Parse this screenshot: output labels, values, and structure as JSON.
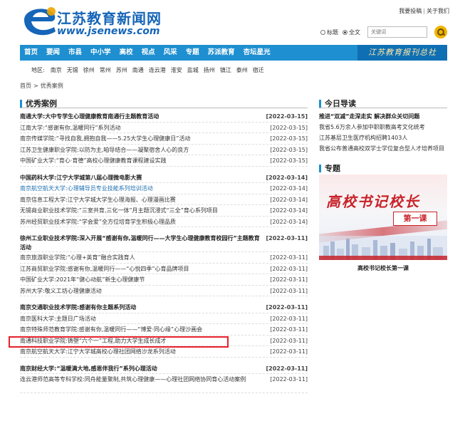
{
  "header": {
    "site_name": "江苏教育新闻网",
    "site_url": "www.jsenews.com",
    "top_links": [
      "我要投稿",
      "关于我们"
    ],
    "search": {
      "radio_title": "标题",
      "radio_full": "全文",
      "placeholder": "关键词"
    }
  },
  "nav": {
    "items": [
      "首页",
      "要闻",
      "市县",
      "中小学",
      "高校",
      "视点",
      "风采",
      "专题",
      "苏派教育",
      "杏坛星光"
    ],
    "banner": "江苏教育报刊总社"
  },
  "region": {
    "label": "地区:",
    "items": [
      "南京",
      "无锡",
      "徐州",
      "常州",
      "苏州",
      "南通",
      "连云港",
      "淮安",
      "盐城",
      "扬州",
      "镇江",
      "泰州",
      "宿迁"
    ]
  },
  "breadcrumb": [
    "首页",
    "优秀案例"
  ],
  "left": {
    "title": "优秀案例",
    "groups": [
      {
        "head": {
          "text": "南通大学:大中专学生心理健康教育南通行主题教育活动",
          "date": "[2022-03-15]"
        },
        "rows": [
          {
            "text": "江南大学:“感谢有你,温暖同行”系列活动",
            "date": "[2022-03-15]"
          },
          {
            "text": "南京传媒学院:“寻找自我,拥抱自我——5.25大学生心理健康日”活动",
            "date": "[2022-03-15]"
          },
          {
            "text": "江苏卫生健康职业学院:以防为主,咱导结合——凝聚宿舍人心的良方",
            "date": "[2022-03-15]"
          },
          {
            "text": "中国矿业大学:“育心·育德”高校心理健康教育课程建设实践",
            "date": "[2022-03-15]"
          }
        ]
      },
      {
        "head": {
          "text": "中国药科大学:江宁大学城第八届心理微电影大赛",
          "date": "[2022-03-14]"
        },
        "rows": [
          {
            "text": "南京航空航天大学:心理辅导员专业技能系列培训活动",
            "date": "[2022-03-14]",
            "link": true
          },
          {
            "text": "南京信息工程大学:江宁大学城大学生心理海报、心理漫画比赛",
            "date": "[2022-03-14]"
          },
          {
            "text": "无锡商业职业技术学院:“三室共育,三化一体”月主题沉浸式“三全”育心系列项目",
            "date": "[2022-03-14]"
          },
          {
            "text": "苏州经贸职业技术学院:“学会爱”全方位培育学生积极心理品质",
            "date": "[2022-03-14]"
          }
        ]
      },
      {
        "head": {
          "text": "徐州工业职业技术学院:深入开展“感谢有你,温暖同行——大学生心理健康教育校园行”主题教育活动",
          "date": "[2022-03-11]",
          "tall": true
        },
        "rows": [
          {
            "text": "南京旅游职业学院:“心理+英育”融合实践育人",
            "date": "[2022-03-11]"
          },
          {
            "text": "江苏商贸职业学院:感谢有你,温暖同行——“心悦四季”心育品牌项目",
            "date": "[2022-03-11]"
          },
          {
            "text": "中国矿业大学:2021年“健心动航”新生心理健康节",
            "date": "[2022-03-11]"
          },
          {
            "text": "苏州大学:敬义工坊心理健康活动",
            "date": "[2022-03-11]"
          }
        ]
      },
      {
        "head": {
          "text": "南京交通职业技术学院:感谢有你主题系列活动",
          "date": "[2022-03-11]"
        },
        "rows": [
          {
            "text": "南京医科大学:主题日广场活动",
            "date": "[2022-03-11]"
          },
          {
            "text": "南京特殊师范教育学院:感谢有你,温暖同行——“博爱·同心缘”心理沙画会",
            "date": "[2022-03-11]"
          },
          {
            "text": "南通科技职业学院:铸塑“六个一”工程,助力大学生成长成才",
            "date": "[2022-03-11]"
          },
          {
            "text": "南京航空航天大学:江宁大学城高校心理社团网络沙龙系列活动",
            "date": "[2022-03-11]"
          }
        ]
      },
      {
        "head": {
          "text": "南京财经大学:“温暖满大地,感恩伴我行”系列心理活动",
          "date": "[2022-03-11]"
        },
        "rows": [
          {
            "text": "连云港师范高等专科学校:同舟能量聚制,共筑心理健康——心理社团网络协同育心活动案例",
            "date": "[2022-03-11]",
            "tall": true
          }
        ]
      }
    ]
  },
  "right": {
    "today_title": "今日导读",
    "today_items": [
      {
        "text": "推进“双减”走深走实 解决群众关切问题",
        "bold": true
      },
      {
        "text": "我省5.6万余人参加中职职教高考文化统考",
        "bold": false
      },
      {
        "text": "江苏基层卫生医疗机构招聘1403人",
        "bold": false
      },
      {
        "text": "我省公布普通高校双学士学位复合型人才培养项目",
        "bold": false
      }
    ],
    "special_title": "专题",
    "special_image_text": "高校书记校长",
    "special_image_badge": "第一课",
    "special_caption": "高校书记校长第一课"
  }
}
